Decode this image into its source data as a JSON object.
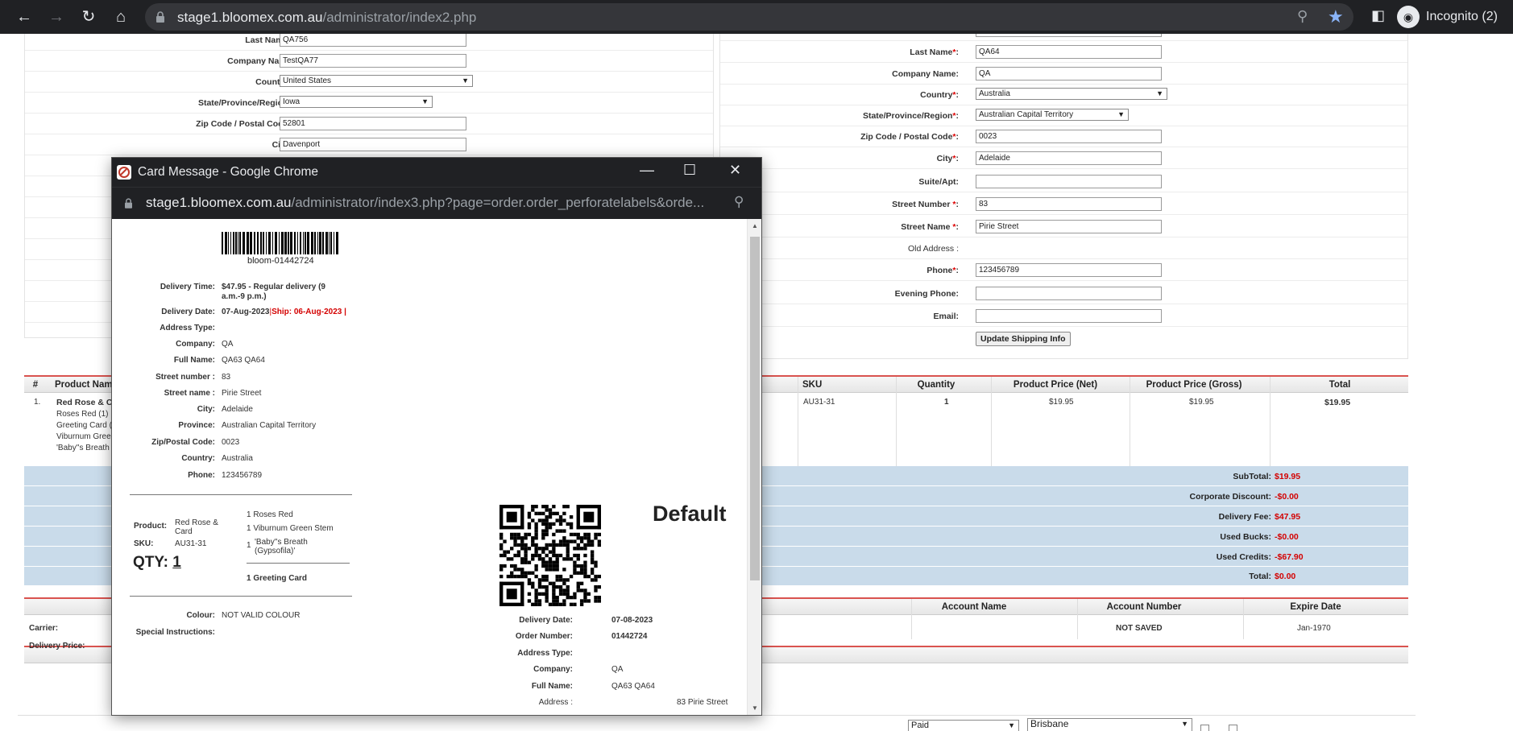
{
  "browser": {
    "url_host": "stage1.bloomex.com.au",
    "url_path": "/administrator/index2.php",
    "incognito_label": "Incognito (2)",
    "icons": [
      "back-arrow-icon",
      "forward-arrow-icon",
      "reload-icon",
      "home-icon",
      "lock-icon",
      "zoom-icon",
      "star-icon",
      "sidepanel-icon",
      "incognito-icon"
    ]
  },
  "billing": {
    "last_name_label": "Last Name",
    "last_name_value": "QA756",
    "company_label": "Company Name:",
    "company_value": "TestQA77",
    "country_label": "Country",
    "country_value": "United States",
    "state_label": "State/Province/Region",
    "state_value": "Iowa",
    "zip_label": "Zip Code / Postal Code",
    "zip_value": "52801",
    "city_label": "City",
    "city_value": "Davenport"
  },
  "shipping": {
    "last_name_label": "Last Name",
    "last_name_value": "QA64",
    "company_label": "Company Name:",
    "company_value": "QA",
    "country_label": "Country",
    "country_value": "Australia",
    "state_label": "State/Province/Region",
    "state_value": "Australian Capital Territory",
    "zip_label": "Zip Code / Postal Code",
    "zip_value": "0023",
    "city_label": "City",
    "city_value": "Adelaide",
    "suite_label": "Suite/Apt:",
    "suite_value": "",
    "street_number_label": "Street Number",
    "street_number_value": "83",
    "street_name_label": "Street Name",
    "street_name_value": "Pirie Street",
    "old_address_label": "Old Address :",
    "phone_label": "Phone",
    "phone_value": "123456789",
    "evening_phone_label": "Evening Phone:",
    "evening_phone_value": "",
    "email_label": "Email:",
    "email_value": "",
    "update_button": "Update Shipping Info"
  },
  "order": {
    "headers": {
      "num": "#",
      "product": "Product Nam",
      "sku": "SKU",
      "quantity": "Quantity",
      "price_net": "Product Price (Net)",
      "price_gross": "Product Price (Gross)",
      "total": "Total"
    },
    "row": {
      "num": "1.",
      "product": "Red Rose & C",
      "items": [
        "Roses Red (1)",
        "Greeting Card (",
        "Viburnum Gree",
        "'Baby''s Breath"
      ],
      "sku": "AU31-31",
      "quantity": "1",
      "price_net": "$19.95",
      "price_gross": "$19.95",
      "total": "$19.95"
    },
    "totals": [
      {
        "label": "SubTotal:",
        "value": "$19.95"
      },
      {
        "label": "Corporate Discount:",
        "value": "-$0.00"
      },
      {
        "label": "Delivery Fee:",
        "value": "$47.95"
      },
      {
        "label": "Used Bucks:",
        "value": "-$0.00"
      },
      {
        "label": "Used Credits:",
        "value": "-$67.90"
      },
      {
        "label": "Total:",
        "value": "$0.00"
      }
    ]
  },
  "payment": {
    "carrier_label": "Carrier:",
    "delivery_price_label": "Delivery Price:",
    "account_name_header": "Account Name",
    "account_number_header": "Account Number",
    "expire_date_header": "Expire Date",
    "account_number_value": "NOT SAVED",
    "expire_date_value": "Jan-1970"
  },
  "bottom": {
    "status_select": "Paid",
    "location_select": "Brisbane"
  },
  "popup": {
    "title": "Card Message - Google Chrome",
    "url_host": "stage1.bloomex.com.au",
    "url_path": "/administrator/index3.php?page=order.order_perforatelabels&orde...",
    "barcode_text": "bloom-01442724",
    "details": [
      {
        "label": "Delivery Time:",
        "value": "$47.95 - Regular delivery (9 a.m.-9 p.m.)"
      },
      {
        "label": "Delivery Date:",
        "value": "07-Aug-2023",
        "ship": "Ship: 06-Aug-2023 |"
      },
      {
        "label": "Address Type:",
        "value": ""
      },
      {
        "label": "Company:",
        "value": "QA"
      },
      {
        "label": "Full Name:",
        "value": "QA63 QA64"
      },
      {
        "label": "Street number :",
        "value": "83"
      },
      {
        "label": "Street name :",
        "value": "Pirie Street"
      },
      {
        "label": "City:",
        "value": "Adelaide"
      },
      {
        "label": "Province:",
        "value": "Australian Capital Territory"
      },
      {
        "label": "Zip/Postal Code:",
        "value": "0023"
      },
      {
        "label": "Country:",
        "value": "Australia"
      },
      {
        "label": "Phone:",
        "value": "123456789"
      }
    ],
    "product_label": "Product:",
    "product_value": "Red Rose & Card",
    "sku_label": "SKU:",
    "sku_value": "AU31-31",
    "qty_label": "QTY:",
    "qty_value": "1",
    "components": [
      "1 Roses Red",
      "1 Viburnum Green Stem",
      "1",
      "'Baby''s Breath (Gypsofila)'"
    ],
    "greeting": "1 Greeting Card",
    "colour_label": "Colour:",
    "colour_value": "NOT VALID COLOUR",
    "special_label": "Special Instructions:",
    "default_label": "Default",
    "right": [
      {
        "label": "Delivery Date:",
        "value": "07-08-2023"
      },
      {
        "label": "Order Number:",
        "value": "01442724"
      },
      {
        "label": "Address Type:",
        "value": ""
      },
      {
        "label": "Company:",
        "value": "QA"
      },
      {
        "label": "Full Name:",
        "value": "QA63 QA64"
      },
      {
        "label": "Address :",
        "value": "83 Pirie Street"
      }
    ]
  }
}
